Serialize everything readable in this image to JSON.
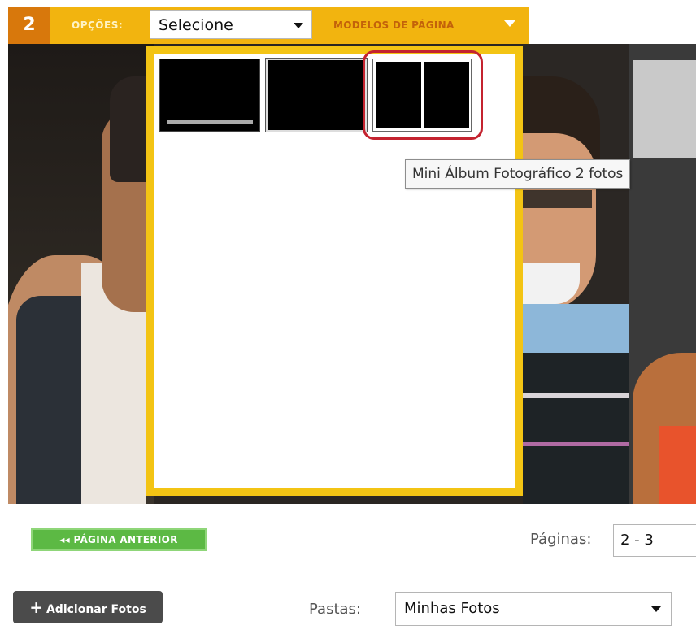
{
  "toolbar": {
    "page_number": "2",
    "options_label": "OPÇÕES:",
    "options_select_value": "Selecione",
    "models_label": "MODELOS DE PÁGINA"
  },
  "templates": {
    "tooltip": "Mini Álbum Fotográfico 2 fotos"
  },
  "navigation": {
    "prev_label": "◂◂ PÁGINA ANTERIOR",
    "pages_label": "Páginas:",
    "pages_value": "2 - 3"
  },
  "footer": {
    "add_label": "Adicionar Fotos",
    "folders_label": "Pastas:",
    "folders_value": "Minhas Fotos"
  },
  "colors": {
    "toolbar_bg": "#f2b40f",
    "page_number_bg": "#d8780c",
    "panel_border": "#f3c414",
    "highlight": "#c4232f",
    "prev_button": "#5cb944",
    "add_button": "#4b4b4b"
  },
  "icons": [
    "chevron-down-icon",
    "plus-icon",
    "double-left-arrow-icon"
  ]
}
